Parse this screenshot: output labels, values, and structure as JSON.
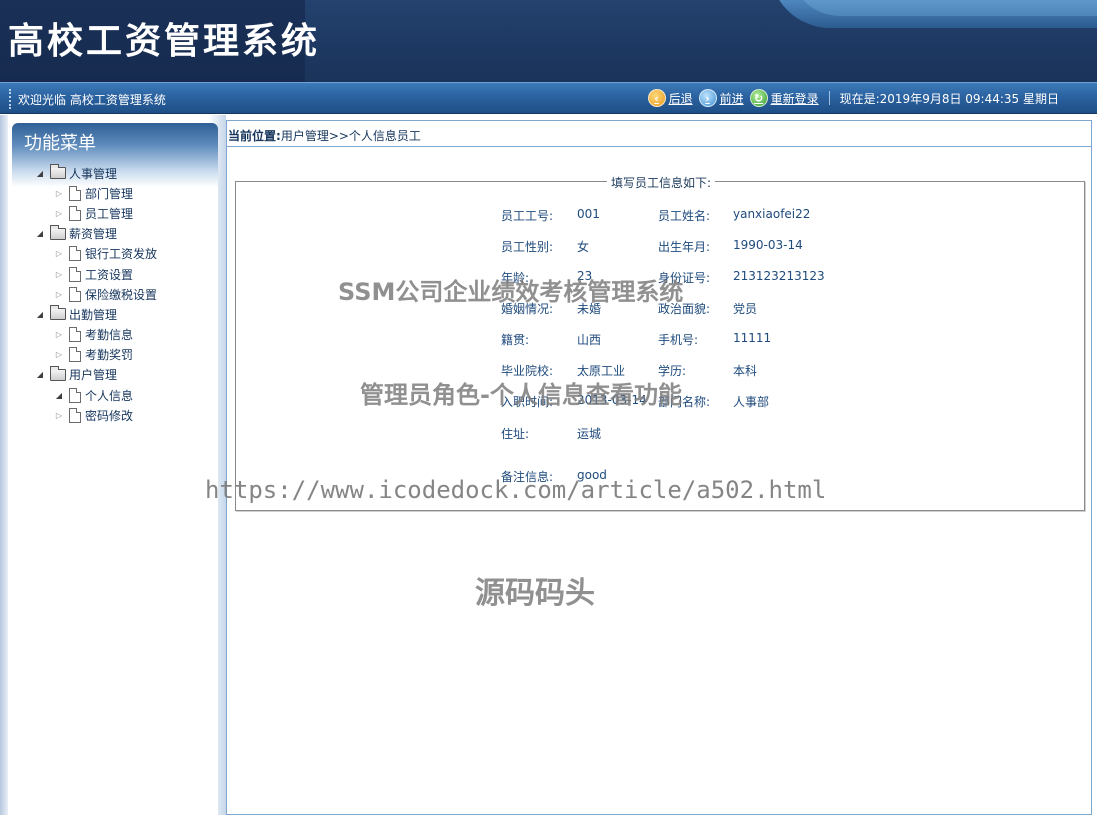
{
  "header": {
    "app_title": "高校工资管理系统"
  },
  "navbar": {
    "welcome": "欢迎光临 高校工资管理系统",
    "back_label": "后退",
    "forward_label": "前进",
    "relogin_label": "重新登录",
    "datetime": "现在是:2019年9月8日 09:44:35 星期日"
  },
  "sidebar": {
    "title": "功能菜单",
    "groups": [
      {
        "label": "人事管理",
        "expanded": true,
        "items": [
          {
            "label": "部门管理"
          },
          {
            "label": "员工管理"
          }
        ]
      },
      {
        "label": "薪资管理",
        "expanded": true,
        "items": [
          {
            "label": "银行工资发放"
          },
          {
            "label": "工资设置"
          },
          {
            "label": "保险缴税设置"
          }
        ]
      },
      {
        "label": "出勤管理",
        "expanded": true,
        "items": [
          {
            "label": "考勤信息"
          },
          {
            "label": "考勤奖罚"
          }
        ]
      },
      {
        "label": "用户管理",
        "expanded": true,
        "items": [
          {
            "label": "个人信息",
            "expanded": true
          },
          {
            "label": "密码修改"
          }
        ]
      }
    ]
  },
  "main": {
    "breadcrumb_prefix": "当前位置:",
    "breadcrumb_path": "用户管理>>个人信息员工",
    "legend": "填写员工信息如下:",
    "fields": {
      "emp_no_label": "员工工号:",
      "emp_no": "001",
      "emp_name_label": "员工姓名:",
      "emp_name": "yanxiaofei22",
      "gender_label": "员工性别:",
      "gender": "女",
      "birth_label": "出生年月:",
      "birth": "1990-03-14",
      "age_label": "年龄:",
      "age": "23",
      "id_label": "身份证号:",
      "id_no": "213123213123",
      "marriage_label": "婚姻情况:",
      "marriage": "未婚",
      "politics_label": "政治面貌:",
      "politics": "党员",
      "native_label": "籍贯:",
      "native": "山西",
      "phone_label": "手机号:",
      "phone": "11111",
      "school_label": "毕业院校:",
      "school": "太原工业",
      "degree_label": "学历:",
      "degree": "本科",
      "hire_label": "入职时间:",
      "hire": "2013-03-14",
      "dept_label": "部门名称:",
      "dept": "人事部",
      "address_label": "住址:",
      "address": "运城",
      "remark_label": "备注信息:",
      "remark": "good"
    }
  },
  "watermarks": {
    "line1": "SSM公司企业绩效考核管理系统",
    "line2": "管理员角色-个人信息查看功能",
    "line3": "https://www.icodedock.com/article/a502.html",
    "line4": "源码码头"
  }
}
